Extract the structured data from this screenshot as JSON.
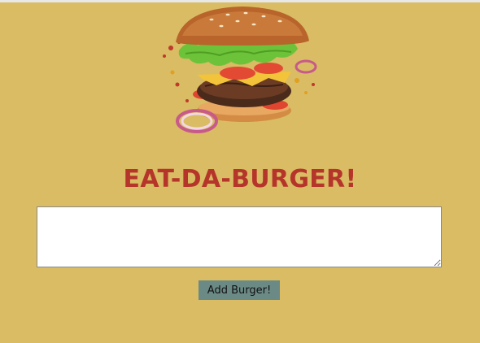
{
  "header": {
    "title": "EAT-DA-BURGER!"
  },
  "form": {
    "burger_input_value": "",
    "submit_label": "Add Burger!"
  },
  "colors": {
    "background": "#d9bc63",
    "title": "#b5352a",
    "button": "#6b8a86"
  }
}
